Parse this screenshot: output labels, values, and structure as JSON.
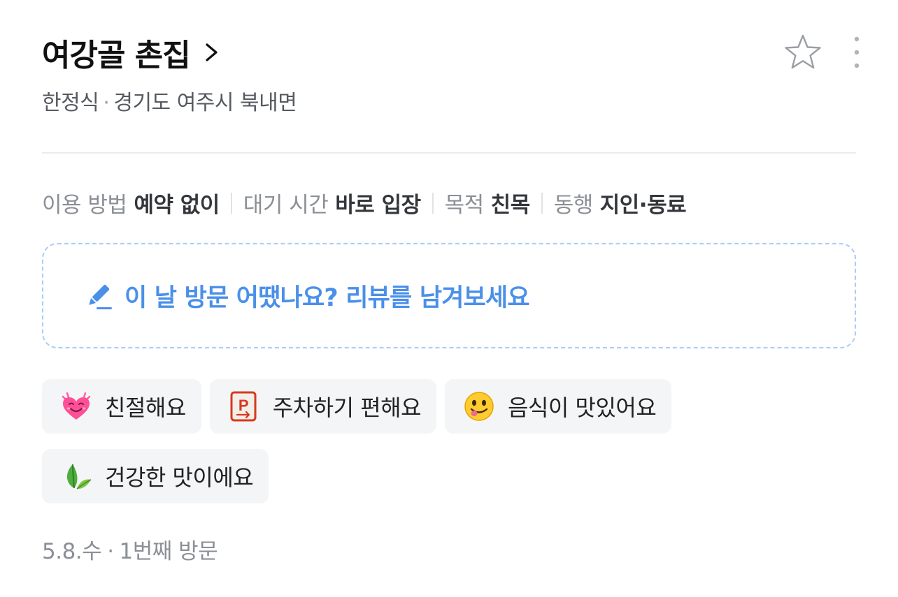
{
  "place": {
    "name": "여강골 촌집",
    "category": "한정식",
    "separator": "·",
    "location": "경기도 여주시 북내면"
  },
  "meta": [
    {
      "key": "이용 방법",
      "value": "예약 없이"
    },
    {
      "key": "대기 시간",
      "value": "바로 입장"
    },
    {
      "key": "목적",
      "value": "친목"
    },
    {
      "key": "동행",
      "value": "지인·동료"
    }
  ],
  "review_prompt": {
    "label": "이 날 방문 어땠나요? 리뷰를 남겨보세요",
    "icon": "pencil-icon",
    "color": "#4a90e9"
  },
  "tags": [
    {
      "label": "친절해요",
      "icon": "smiling-heart-icon"
    },
    {
      "label": "주차하기 편해요",
      "icon": "parking-sign-icon"
    },
    {
      "label": "음식이 맛있어요",
      "icon": "yum-face-icon"
    },
    {
      "label": "건강한 맛이에요",
      "icon": "leaf-icon"
    }
  ],
  "visit": {
    "date": "5.8.수",
    "separator": "·",
    "count": "1번째 방문"
  }
}
